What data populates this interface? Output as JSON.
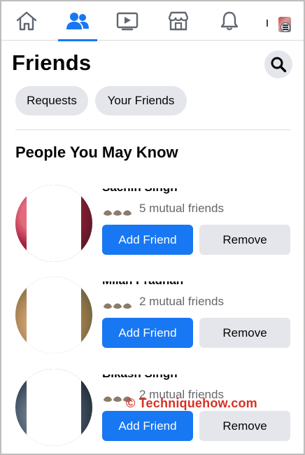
{
  "nav": {
    "items": [
      {
        "name": "home",
        "icon": "home-icon"
      },
      {
        "name": "friends",
        "icon": "friends-icon",
        "active": true
      },
      {
        "name": "watch",
        "icon": "video-icon"
      },
      {
        "name": "marketplace",
        "icon": "store-icon"
      },
      {
        "name": "notifications",
        "icon": "bell-icon"
      },
      {
        "name": "menu",
        "icon": "menu-icon"
      }
    ],
    "accent_color": "#1877f2"
  },
  "page": {
    "title": "Friends"
  },
  "chips": {
    "requests": "Requests",
    "your_friends": "Your Friends"
  },
  "section": {
    "title": "People You May Know"
  },
  "people": [
    {
      "name": "Sachin Singh",
      "mutual": "5 mutual friends",
      "add_label": "Add Friend",
      "remove_label": "Remove"
    },
    {
      "name": "Milan Pradhan",
      "mutual": "2 mutual friends",
      "add_label": "Add Friend",
      "remove_label": "Remove"
    },
    {
      "name": "Bikash Singh",
      "mutual": "2 mutual friends",
      "add_label": "Add Friend",
      "remove_label": "Remove"
    }
  ],
  "watermark": "© Techniquehow.com",
  "colors": {
    "primary_button": "#1877f2",
    "secondary_button": "#e4e6eb",
    "muted_text": "#65676b",
    "watermark": "#d93025"
  }
}
